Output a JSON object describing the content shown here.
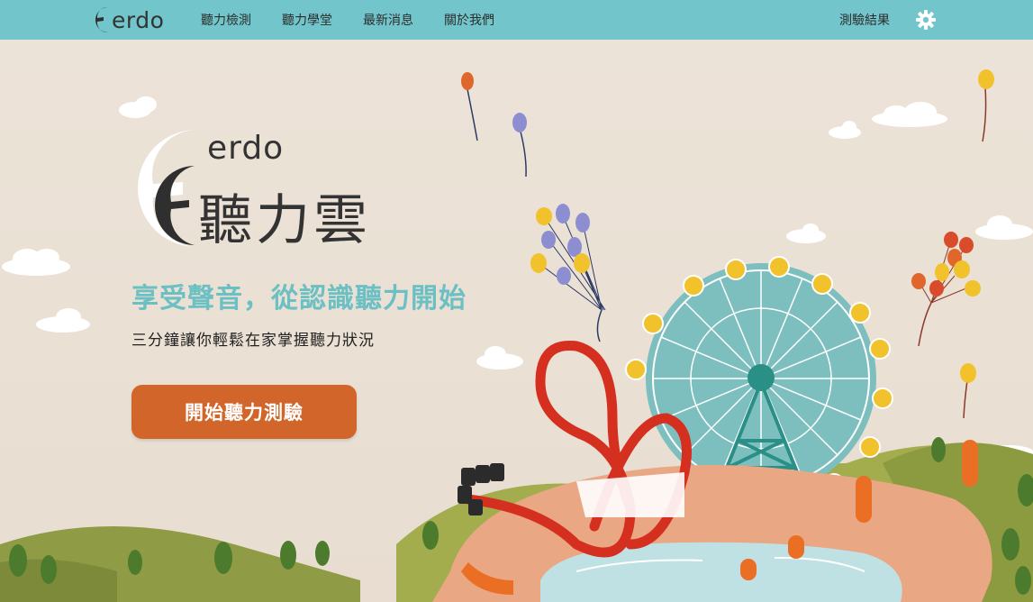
{
  "header": {
    "logo_text": "erdo",
    "nav": [
      {
        "label": "聽力檢測"
      },
      {
        "label": "聽力學堂"
      },
      {
        "label": "最新消息"
      },
      {
        "label": "關於我們"
      }
    ],
    "results_label": "測驗結果",
    "settings_icon": "gear-icon"
  },
  "hero": {
    "brand_en": "erdo",
    "brand_zh": "聽力雲",
    "tagline": "享受聲音，從認識聽力開始",
    "subline": "三分鐘讓你輕鬆在家掌握聽力狀況",
    "cta_label": "開始聽力測驗"
  },
  "colors": {
    "header_bg": "#72c5ca",
    "tagline": "#6cc0c4",
    "cta_bg": "#d2652a",
    "hero_bg": "#ece3d8"
  }
}
